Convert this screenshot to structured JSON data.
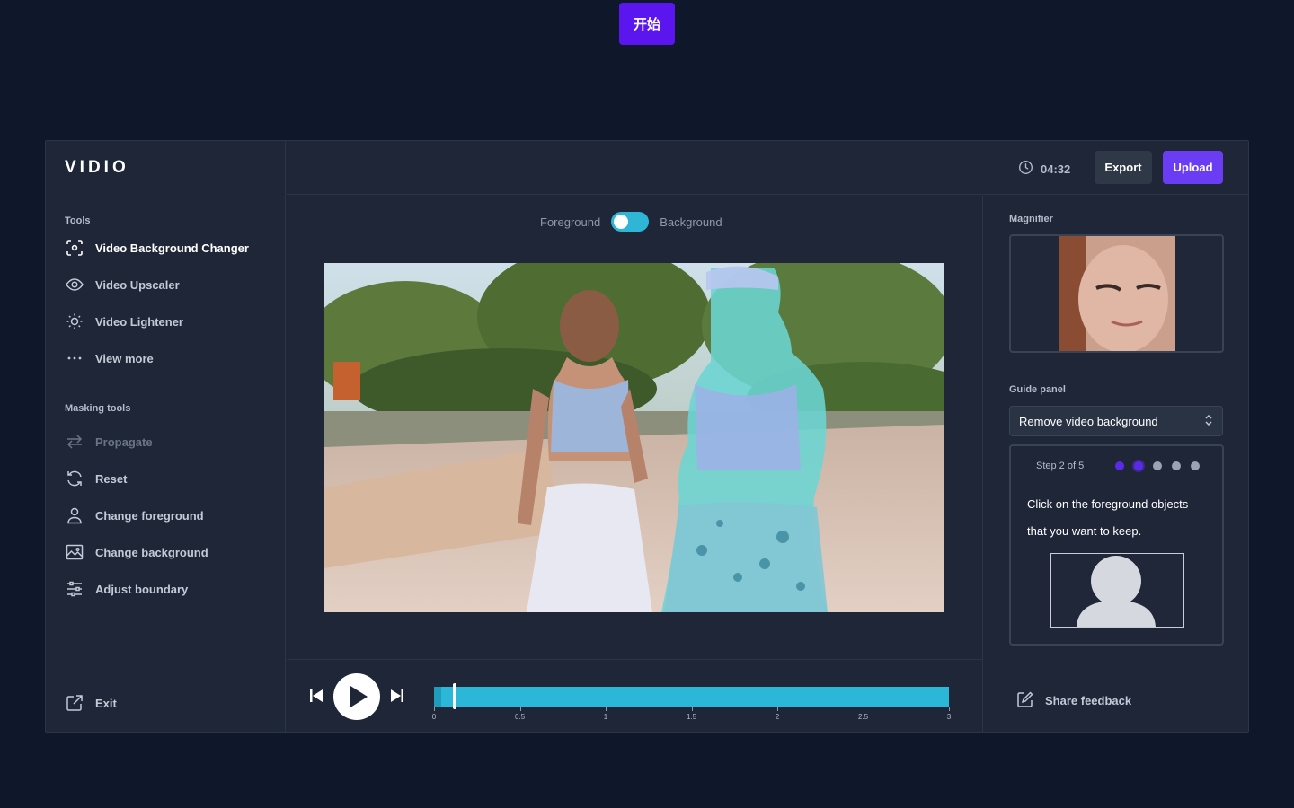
{
  "start_button": "开始",
  "app": {
    "logo": "VIDIO",
    "sidebar": {
      "tools_label": "Tools",
      "tools": [
        {
          "label": "Video Background Changer",
          "icon": "focus-frame-icon"
        },
        {
          "label": "Video Upscaler",
          "icon": "eye-icon"
        },
        {
          "label": "Video Lightener",
          "icon": "sun-icon"
        },
        {
          "label": "View more",
          "icon": "more-dots-icon"
        }
      ],
      "masking_label": "Masking tools",
      "masking_tools": [
        {
          "label": "Propagate",
          "icon": "arrows-swap-icon"
        },
        {
          "label": "Reset",
          "icon": "refresh-icon"
        },
        {
          "label": "Change foreground",
          "icon": "user-icon"
        },
        {
          "label": "Change background",
          "icon": "image-icon"
        },
        {
          "label": "Adjust boundary",
          "icon": "sliders-icon"
        }
      ],
      "exit_label": "Exit"
    },
    "header": {
      "timer": "04:32",
      "export_label": "Export",
      "upload_label": "Upload"
    },
    "editor": {
      "toggle_left": "Foreground",
      "toggle_right": "Background",
      "toggle_state": "on"
    },
    "timeline": {
      "ticks": [
        "0",
        "0.5",
        "1",
        "1.5",
        "2",
        "2.5",
        "3"
      ],
      "playhead": 0.1
    },
    "right_panel": {
      "magnifier_label": "Magnifier",
      "guide_label": "Guide panel",
      "guide_select": "Remove video background",
      "step_text": "Step 2 of 5",
      "current_step": 2,
      "total_steps": 5,
      "guide_line1": "Click on the foreground objects",
      "guide_line2": "that you want to keep.",
      "feedback_label": "Share feedback"
    }
  },
  "colors": {
    "background": "#0f172a",
    "panel": "#1e2637",
    "accent_purple": "#6a3df5",
    "accent_cyan": "#2bb8d8"
  }
}
